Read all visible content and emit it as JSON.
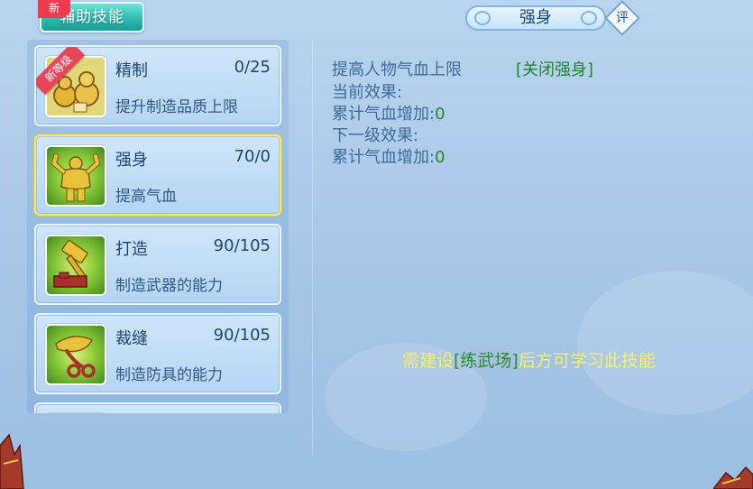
{
  "tab": {
    "label": "辅助技能",
    "badge": "新"
  },
  "skills": [
    {
      "name": "精制",
      "level": "0/25",
      "desc": "提升制造品质上限",
      "ribbon": "新等级",
      "icon": "gourd-icon"
    },
    {
      "name": "强身",
      "level": "70/0",
      "desc": "提高气血",
      "icon": "muscle-man-icon",
      "selected": true
    },
    {
      "name": "打造",
      "level": "90/105",
      "desc": "制造武器的能力",
      "icon": "hammer-icon"
    },
    {
      "name": "裁缝",
      "level": "90/105",
      "desc": "制造防具的能力",
      "icon": "scissors-icon"
    }
  ],
  "detail": {
    "title": "强身",
    "eval_label": "评",
    "line1": "提高人物气血上限",
    "close_link": "[关闭强身]",
    "current_label": "当前效果:",
    "current_value_label": "累计气血增加:",
    "current_value": "0",
    "next_label": "下一级效果:",
    "next_value_label": "累计气血增加:",
    "next_value": "0"
  },
  "notice": {
    "prefix": "需建设",
    "place": "[练武场]",
    "suffix": "后方可学习此技能"
  }
}
